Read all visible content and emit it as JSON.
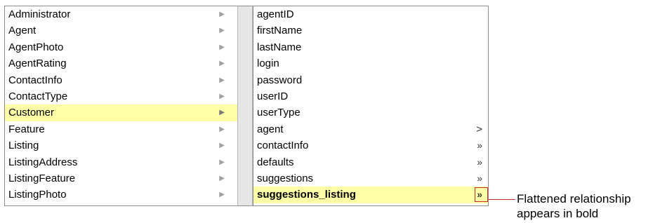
{
  "entities": [
    {
      "label": "Administrator"
    },
    {
      "label": "Agent"
    },
    {
      "label": "AgentPhoto"
    },
    {
      "label": "AgentRating"
    },
    {
      "label": "ContactInfo"
    },
    {
      "label": "ContactType"
    },
    {
      "label": "Customer",
      "selected": true
    },
    {
      "label": "Feature"
    },
    {
      "label": "Listing"
    },
    {
      "label": "ListingAddress"
    },
    {
      "label": "ListingFeature"
    },
    {
      "label": "ListingPhoto"
    }
  ],
  "entity_arrow": "▶",
  "properties": [
    {
      "label": "agentID"
    },
    {
      "label": "firstName"
    },
    {
      "label": "lastName"
    },
    {
      "label": "login"
    },
    {
      "label": "password"
    },
    {
      "label": "userID"
    },
    {
      "label": "userType"
    },
    {
      "label": "agent",
      "arrow": ">"
    },
    {
      "label": "contactInfo",
      "arrow": "»"
    },
    {
      "label": "defaults",
      "arrow": "»"
    },
    {
      "label": "suggestions",
      "arrow": "»"
    },
    {
      "label": "suggestions_listing",
      "arrow": "»",
      "bold": true,
      "selected": true
    }
  ],
  "callout": {
    "line1": "Flattened relationship",
    "line2": "appears in bold"
  },
  "colors": {
    "selection": "#ffffa8",
    "callout": "#cc2a2a"
  }
}
